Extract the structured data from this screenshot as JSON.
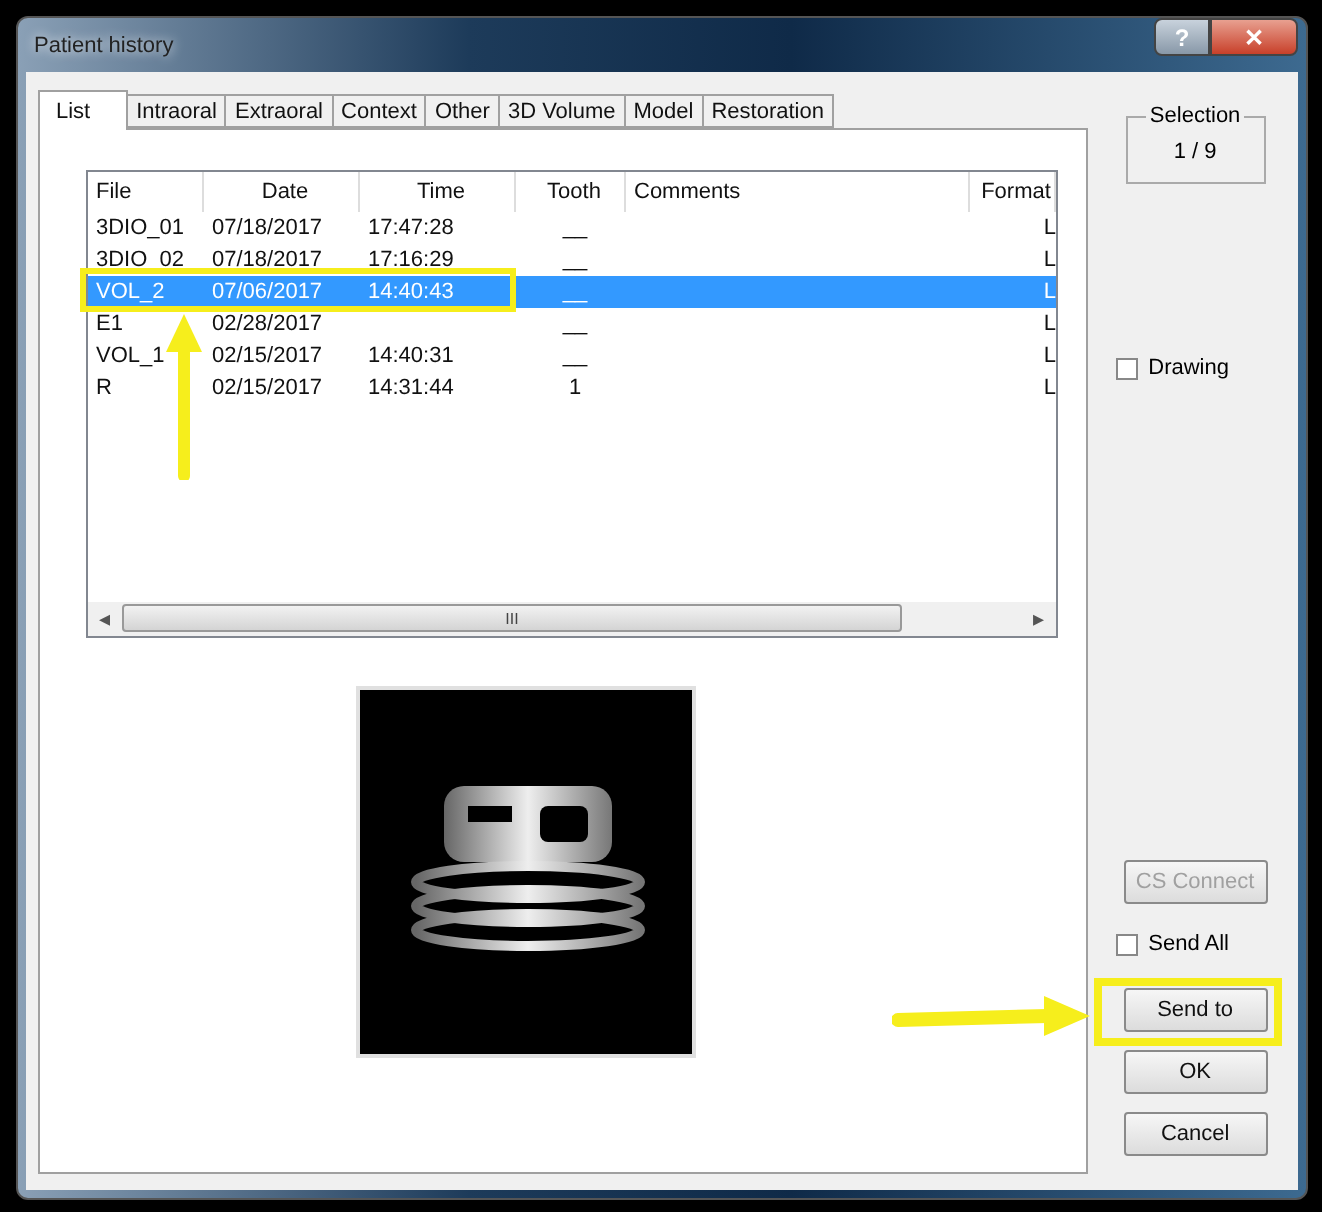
{
  "window": {
    "title": "Patient history",
    "help_button": "?",
    "close_button": "✕"
  },
  "tabs": [
    {
      "label": "List",
      "selected": true
    },
    {
      "label": "Intraoral",
      "selected": false
    },
    {
      "label": "Extraoral",
      "selected": false
    },
    {
      "label": "Context",
      "selected": false
    },
    {
      "label": "Other",
      "selected": false
    },
    {
      "label": "3D Volume",
      "selected": false
    },
    {
      "label": "Model",
      "selected": false
    },
    {
      "label": "Restoration",
      "selected": false
    }
  ],
  "table": {
    "columns": [
      "File",
      "Date",
      "Time",
      "Tooth",
      "Comments",
      "Format"
    ],
    "rows": [
      {
        "cells": [
          "3DIO_01",
          "07/18/2017",
          "17:47:28",
          "__",
          "",
          "L"
        ],
        "selected": false
      },
      {
        "cells": [
          "3DIO_02",
          "07/18/2017",
          "17:16:29",
          "__",
          "",
          "L"
        ],
        "selected": false
      },
      {
        "cells": [
          "VOL_2",
          "07/06/2017",
          "14:40:43",
          "__",
          "",
          "L"
        ],
        "selected": true
      },
      {
        "cells": [
          "E1",
          "02/28/2017",
          "",
          "__",
          "",
          "L"
        ],
        "selected": false
      },
      {
        "cells": [
          "VOL_1",
          "02/15/2017",
          "14:40:31",
          "__",
          "",
          "L"
        ],
        "selected": false
      },
      {
        "cells": [
          "R",
          "02/15/2017",
          "14:31:44",
          "1",
          "",
          "L"
        ],
        "selected": false
      }
    ],
    "scroll_grip": "III",
    "scroll_left": "◂",
    "scroll_right": "▸"
  },
  "selection": {
    "label": "Selection",
    "value": "1 / 9"
  },
  "drawing_checkbox": {
    "label": "Drawing",
    "checked": false
  },
  "buttons": [
    {
      "kind": "button",
      "label": "CS Connect",
      "disabled": true
    },
    {
      "kind": "checkbox",
      "label": "Send All",
      "checked": false
    },
    {
      "kind": "button",
      "label": "Send to",
      "disabled": false
    },
    {
      "kind": "button",
      "label": "OK",
      "disabled": false
    },
    {
      "kind": "button",
      "label": "Cancel",
      "disabled": false
    }
  ]
}
